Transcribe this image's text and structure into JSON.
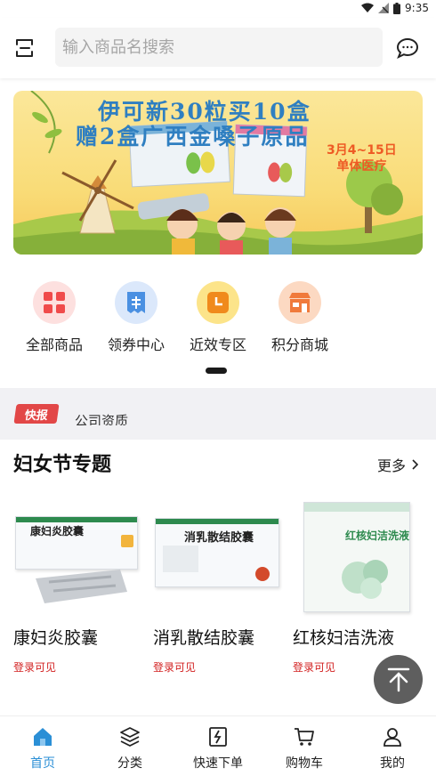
{
  "status_bar": {
    "time": "9:35"
  },
  "header": {
    "search_placeholder": "输入商品名搜索"
  },
  "banner": {
    "line1": "伊可新30粒买10盒",
    "line2": "赠2盒广西金嗓子原品",
    "date": "3月4~15日",
    "store": "单体医疗"
  },
  "categories": [
    {
      "label": "全部商品",
      "icon": "grid-icon",
      "color": "#f04b4b",
      "bg": "#fde0df"
    },
    {
      "label": "领券中心",
      "icon": "coupon-icon",
      "color": "#4a90e2",
      "bg": "#dbe8fb"
    },
    {
      "label": "近效专区",
      "icon": "clock-icon",
      "color": "#f08a1c",
      "bg": "#fce48a"
    },
    {
      "label": "积分商城",
      "icon": "shop-icon",
      "color": "#f07a3c",
      "bg": "#fcd9c2"
    }
  ],
  "news": {
    "badge": "快报",
    "text": "公司资质"
  },
  "section": {
    "title": "妇女节专题",
    "more": "更多"
  },
  "products": [
    {
      "name": "康妇炎胶囊",
      "price_text": "登录可见"
    },
    {
      "name": "消乳散结胶囊",
      "price_text": "登录可见"
    },
    {
      "name": "红核妇洁洗液",
      "price_text": "登录可见"
    }
  ],
  "tabs": [
    {
      "label": "首页",
      "icon": "home-icon",
      "active": true
    },
    {
      "label": "分类",
      "icon": "layers-icon",
      "active": false
    },
    {
      "label": "快速下单",
      "icon": "quick-order-icon",
      "active": false
    },
    {
      "label": "购物车",
      "icon": "cart-icon",
      "active": false
    },
    {
      "label": "我的",
      "icon": "user-icon",
      "active": false
    }
  ],
  "colors": {
    "accent": "#2b8fd6",
    "price": "#d21f1f",
    "badge": "#e24747"
  }
}
